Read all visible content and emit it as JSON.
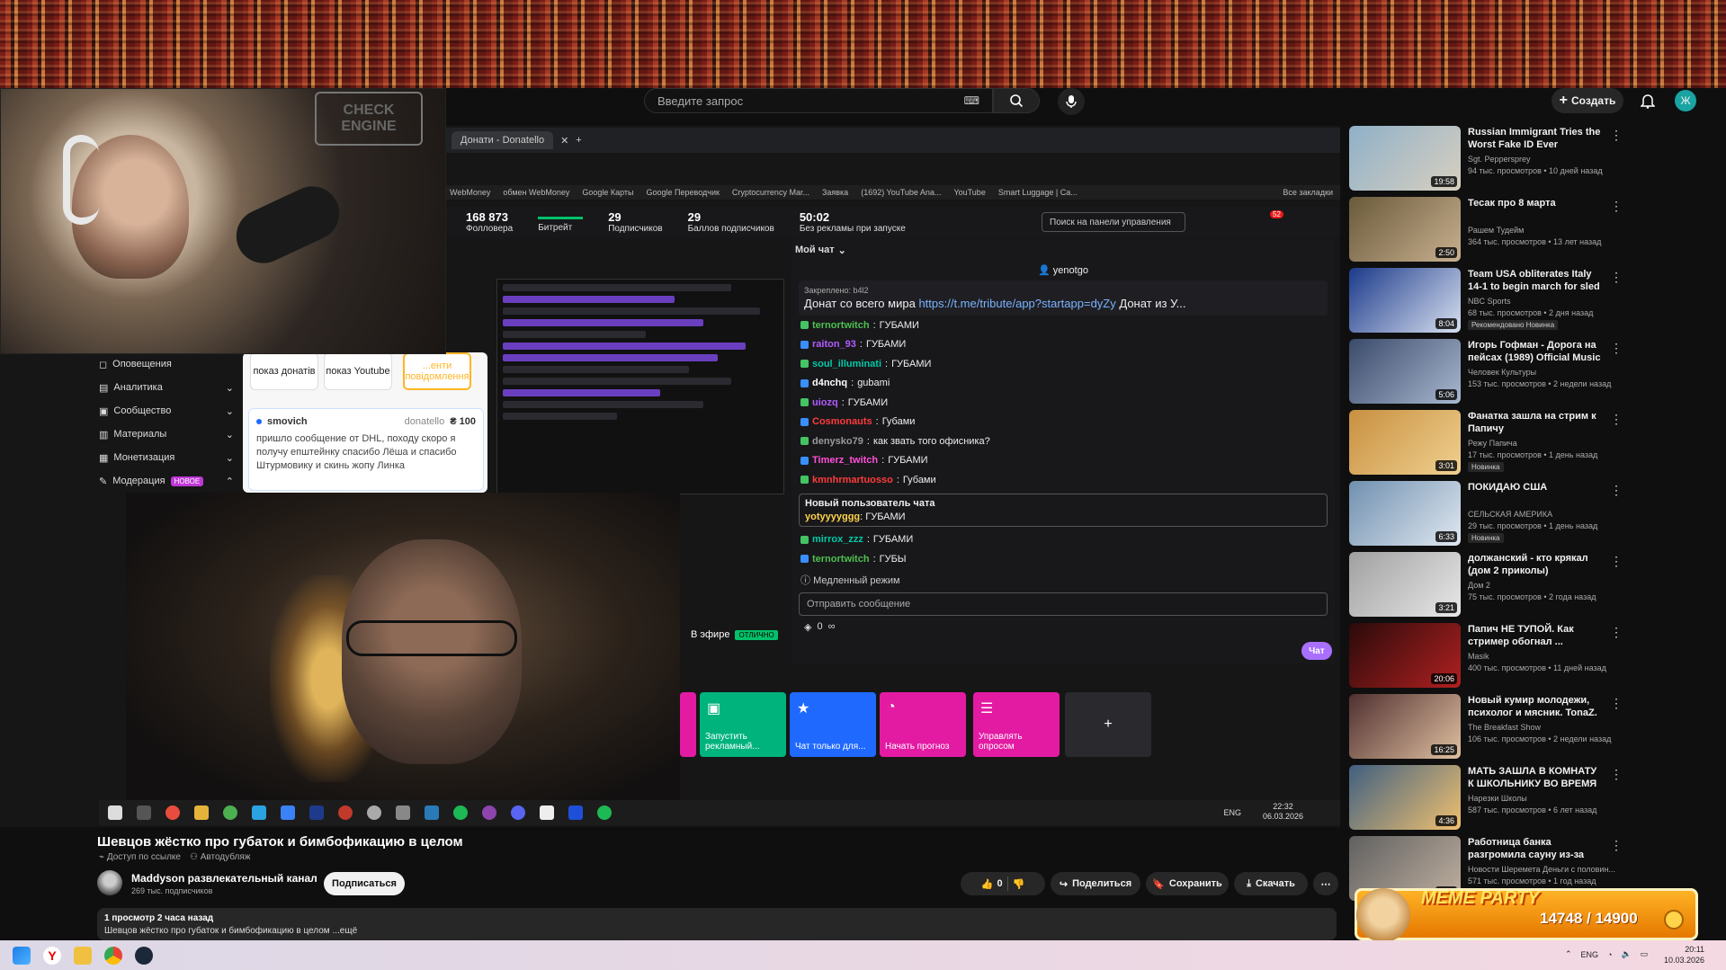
{
  "header": {
    "search_placeholder": "Введите запрос",
    "create_label": "Создать",
    "avatar_letter": "Ж"
  },
  "stream": {
    "webcam_sign": "CHECK ENGINE",
    "browser_tab": "Донати - Donatello",
    "bookmarks": [
      "WebMoney",
      "обмен WebMoney",
      "Google Карты",
      "Google Переводчик",
      "Cryptocurrency Mar...",
      "Заявка",
      "(1692) YouTube Ana...",
      "YouTube",
      "Smart Luggage | Ca...",
      "Все закладки"
    ],
    "stats": [
      {
        "value": "168 873",
        "label": "Фолловера"
      },
      {
        "value": "",
        "label": "Битрейт"
      },
      {
        "value": "29",
        "label": "Подписчиков"
      },
      {
        "value": "29",
        "label": "Баллов подписчиков"
      },
      {
        "value": "50:02",
        "label": "Без рекламы при запуске"
      }
    ],
    "dashboard_search": "Поиск на панели управления",
    "notif_count": "52",
    "left_menu": [
      "Оповещения",
      "Аналитика",
      "Сообщество",
      "Материалы",
      "Монетизация",
      "Модерация"
    ],
    "new_badge": "НОВОЕ",
    "alert_buttons": [
      "показ донатів",
      "показ Youtube",
      "...енти повідомлення"
    ],
    "donation": {
      "user": "smovich",
      "service": "donatello",
      "amount": "₴ 100",
      "text": "пришло сообщение от DHL, походу скоро я получу епштейнку спасибо Лёша и спасибо Штурмовику и скинь жопу Линка"
    },
    "chat": {
      "header": "Мой чат",
      "channel_user": "yenotgo",
      "pinned_label": "Закреплено: b4l2",
      "pinned_text": "Донат со всего мира",
      "pinned_link": "https://t.me/tribute/app?startapp=dyZy",
      "pinned_tail": "Донат из У...",
      "messages": [
        {
          "user": "ternortwitch",
          "text": "ГУБАМИ",
          "color": "#4fc04f"
        },
        {
          "user": "raiton_93",
          "text": "ГУБАМИ",
          "color": "#b05cff"
        },
        {
          "user": "soul_illuminati",
          "text": "ГУБАМИ",
          "color": "#00c9a7"
        },
        {
          "user": "d4nchq",
          "text": "gubami",
          "color": "#ffffff"
        },
        {
          "user": "uiozq",
          "text": "ГУБАМИ",
          "color": "#b05cff"
        },
        {
          "user": "Cosmonauts",
          "text": "Губами",
          "color": "#ff3b3b"
        },
        {
          "user": "denysko79",
          "text": "как звать того офисника?",
          "color": "#9a9a9a"
        },
        {
          "user": "Timerz_twitch",
          "text": "ГУБАМИ",
          "color": "#ff4fd8"
        },
        {
          "user": "kmnhrmartuosso",
          "text": "Губами",
          "color": "#ff3b3b"
        }
      ],
      "new_user_label": "Новый пользователь чата",
      "new_user_msg": {
        "user": "yotyyyyggg",
        "text": "ГУБАМИ",
        "color": "#ffd34a"
      },
      "after": [
        {
          "user": "mirrox_zzz",
          "text": "ГУБАМИ",
          "color": "#00c9a7"
        },
        {
          "user": "ternortwitch",
          "text": "ГУБЫ",
          "color": "#4fc04f"
        }
      ],
      "slow_mode": "Медленный режим",
      "input_placeholder": "Отправить сообщение",
      "points": "0",
      "chat_button": "Чат"
    },
    "live_label": "В эфире",
    "live_status": "ОТЛИЧНО",
    "quick_actions": [
      {
        "label": "Запустить рекламный...",
        "color": "#00b37d"
      },
      {
        "label": "Чат только для...",
        "color": "#1f69ff"
      },
      {
        "label": "Начать прогноз",
        "color": "#e31ba3"
      },
      {
        "label": "Управлять опросом",
        "color": "#e31ba3"
      }
    ],
    "lang": "ENG",
    "clock_time": "22:32",
    "clock_date": "06.03.2026"
  },
  "video": {
    "title": "Шевцов жёстко про губаток и бимбофикацию в целом",
    "tag1": "Доступ по ссылке",
    "tag2": "Автодубляж",
    "channel": "Maddyson развлекательный канал",
    "subs": "269 тыс. подписчиков",
    "subscribe": "Подписаться",
    "likes": "0",
    "share": "Поделиться",
    "save": "Сохранить",
    "download": "Скачать",
    "views_line": "1 просмотр  2 часа назад",
    "desc_line": "Шевцов жёстко про губаток и бимбофикацию в целом ...ещё"
  },
  "recs": [
    {
      "title": "Russian Immigrant Tries the Worst Fake ID Ever",
      "channel": "Sgt. Peppersprey",
      "meta": "94 тыс. просмотров • 10 дней назад",
      "dur": "19:58",
      "badge": "",
      "c1": "#8fb0c8",
      "c2": "#d8d0c0"
    },
    {
      "title": "Тесак про 8 марта",
      "channel": "Рашем Тудейм",
      "meta": "364 тыс. просмотров • 13 лет назад",
      "dur": "2:50",
      "badge": "",
      "c1": "#6a5a3a",
      "c2": "#c8b090"
    },
    {
      "title": "Team USA obliterates Italy 14-1 to begin march for sled hocke...",
      "channel": "NBC Sports",
      "meta": "68 тыс. просмотров • 2 дня назад",
      "dur": "8:04",
      "badge": "Рекомендовано  Новинка",
      "c1": "#1b3a8a",
      "c2": "#d8e0f0"
    },
    {
      "title": "Игорь Гофман - Дорога на пейсах (1989) Official Music ...",
      "channel": "Человек Культуры",
      "meta": "153 тыс. просмотров • 2 недели назад",
      "dur": "5:06",
      "badge": "",
      "c1": "#3a4a6a",
      "c2": "#a8b8d0"
    },
    {
      "title": "Фанатка зашла на стрим к Папичу",
      "channel": "Режу Папича",
      "meta": "17 тыс. просмотров • 1 день назад",
      "dur": "3:01",
      "badge": "Новинка",
      "c1": "#c89040",
      "c2": "#f0d090"
    },
    {
      "title": "ПОКИДАЮ США",
      "channel": "СЕЛЬСКАЯ АМЕРИКА",
      "meta": "29 тыс. просмотров • 1 день назад",
      "dur": "6:33",
      "badge": "Новинка",
      "c1": "#7090b0",
      "c2": "#e0e8f0"
    },
    {
      "title": "должанский - кто крякал (дом 2 приколы)",
      "channel": "Дом 2",
      "meta": "75 тыс. просмотров • 2 года назад",
      "dur": "3:21",
      "badge": "",
      "c1": "#a0a0a0",
      "c2": "#e8e8e8"
    },
    {
      "title": "Папич НЕ ТУПОЙ. Как стример обогнал ...",
      "channel": "Masik",
      "meta": "400 тыс. просмотров • 11 дней назад",
      "dur": "20:06",
      "badge": "",
      "c1": "#2a0a0a",
      "c2": "#b02020"
    },
    {
      "title": "Новый кумир молодежи, психолог и мясник. TonaZ. ...",
      "channel": "The Breakfast Show",
      "meta": "106 тыс. просмотров • 2 недели назад",
      "dur": "16:25",
      "badge": "",
      "c1": "#503030",
      "c2": "#e0c0a0"
    },
    {
      "title": "МАТЬ ЗАШЛА В КОМНАТУ К ШКОЛЬНИКУ ВО ВРЕМЯ ...",
      "channel": "Нарезки Школы",
      "meta": "587 тыс. просмотров • 6 лет назад",
      "dur": "4:36",
      "badge": "",
      "c1": "#406080",
      "c2": "#f0c070"
    },
    {
      "title": "Работница банка разгромила сауну из-за 2000 рублей. Реа...",
      "channel": "Новости Шеремета Деньги с половин...",
      "meta": "571 тыс. просмотров • 1 год назад",
      "dur": "4:16",
      "badge": "",
      "c1": "#606060",
      "c2": "#c0b0a0"
    }
  ],
  "meme": {
    "title": "MEME PARTY",
    "count": "14748 / 14900"
  },
  "host": {
    "lang": "ENG",
    "time": "20:11",
    "date": "10.03.2026"
  }
}
